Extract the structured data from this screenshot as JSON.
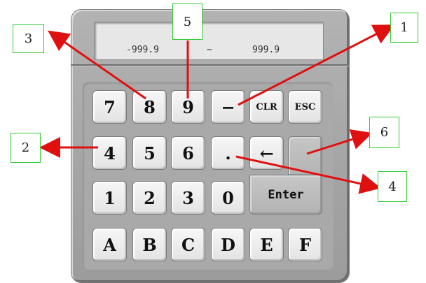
{
  "display": {
    "min": "-999.9",
    "separator": "~",
    "max": "999.9"
  },
  "keys": {
    "k7": "7",
    "k8": "8",
    "k9": "9",
    "minus": "−",
    "clr": "CLR",
    "esc": "ESC",
    "k4": "4",
    "k5": "5",
    "k6": "6",
    "dot": ".",
    "backspace": "←",
    "k1": "1",
    "k2": "2",
    "k3": "3",
    "k0": "0",
    "enter": "Enter",
    "A": "A",
    "B": "B",
    "C": "C",
    "D": "D",
    "E": "E",
    "F": "F"
  },
  "callouts": {
    "c1": "1",
    "c2": "2",
    "c3": "3",
    "c4": "4",
    "c5": "5",
    "c6": "6"
  },
  "colors": {
    "arrow": "#e01010",
    "callout_border": "#33cc33",
    "panel": "#a8a8a8"
  }
}
